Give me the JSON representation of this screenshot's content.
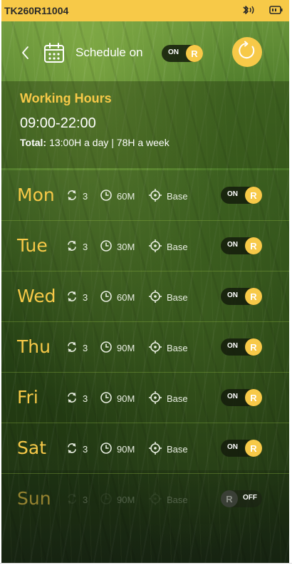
{
  "status_bar": {
    "device_id": "TK260R11004",
    "icons": [
      "bluetooth-audio-icon",
      "battery-icon"
    ]
  },
  "header": {
    "back_icon": "chevron-left-icon",
    "calendar_icon": "calendar-icon",
    "title": "Schedule on",
    "toggle_label": "ON",
    "toggle_knob": "R",
    "toggle_state": "on",
    "refresh_icon": "refresh-icon"
  },
  "working_hours": {
    "title": "Working Hours",
    "range": "09:00-22:00",
    "total_label": "Total:",
    "total_value": "13:00H a day | 78H a week"
  },
  "days": [
    {
      "name": "Mon",
      "repeat": "3",
      "duration": "60M",
      "zone": "Base",
      "toggle_label": "ON",
      "knob": "R",
      "enabled": true
    },
    {
      "name": "Tue",
      "repeat": "3",
      "duration": "30M",
      "zone": "Base",
      "toggle_label": "ON",
      "knob": "R",
      "enabled": true
    },
    {
      "name": "Wed",
      "repeat": "3",
      "duration": "60M",
      "zone": "Base",
      "toggle_label": "ON",
      "knob": "R",
      "enabled": true
    },
    {
      "name": "Thu",
      "repeat": "3",
      "duration": "90M",
      "zone": "Base",
      "toggle_label": "ON",
      "knob": "R",
      "enabled": true
    },
    {
      "name": "Fri",
      "repeat": "3",
      "duration": "90M",
      "zone": "Base",
      "toggle_label": "ON",
      "knob": "R",
      "enabled": true
    },
    {
      "name": "Sat",
      "repeat": "3",
      "duration": "90M",
      "zone": "Base",
      "toggle_label": "ON",
      "knob": "R",
      "enabled": true
    },
    {
      "name": "Sun",
      "repeat": "3",
      "duration": "90M",
      "zone": "Base",
      "toggle_label": "OFF",
      "knob": "R",
      "enabled": false
    }
  ],
  "colors": {
    "accent": "#f7c948",
    "text": "#ffffff",
    "background": "#3d6621"
  }
}
